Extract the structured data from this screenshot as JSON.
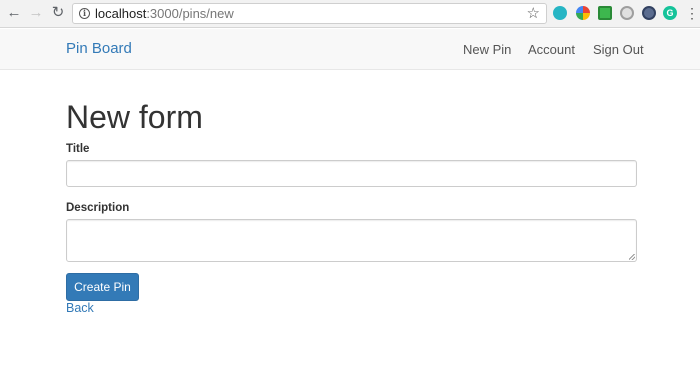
{
  "browser": {
    "back_glyph": "←",
    "forward_glyph": "→",
    "reload_glyph": "↻",
    "url_host": "localhost",
    "url_rest": ":3000/pins/new",
    "star_glyph": "☆",
    "extension_6_letter": "G",
    "menu_glyph": "⋮"
  },
  "navbar": {
    "brand": "Pin Board",
    "links": [
      {
        "label": "New Pin"
      },
      {
        "label": "Account"
      },
      {
        "label": "Sign Out"
      }
    ]
  },
  "form": {
    "heading": "New form",
    "title_label": "Title",
    "title_value": "",
    "description_label": "Description",
    "description_value": "",
    "submit_label": "Create Pin",
    "back_label": "Back"
  },
  "colors": {
    "link": "#337ab7",
    "primary_button": "#337ab7",
    "navbar_bg": "#f8f8f8"
  }
}
